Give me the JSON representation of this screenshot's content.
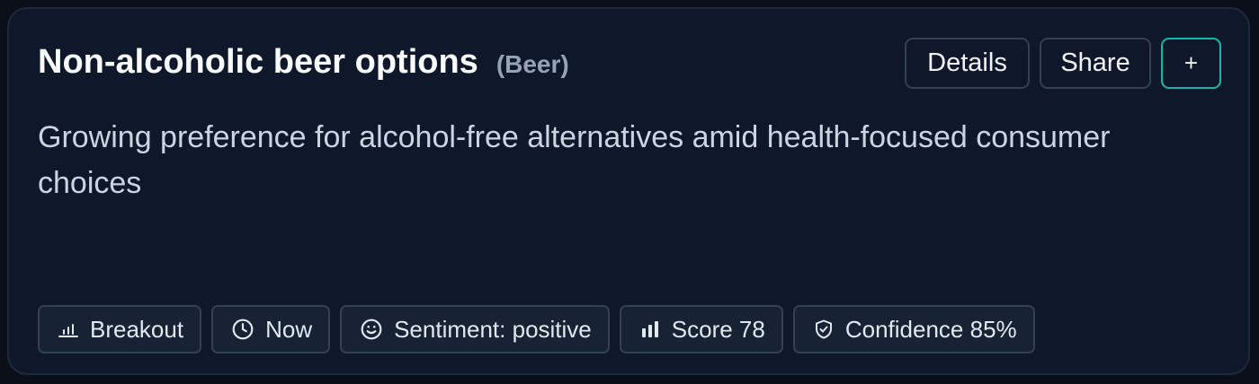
{
  "card": {
    "title": "Non-alcoholic beer options",
    "category": "(Beer)",
    "description": "Growing preference for alcohol-free alternatives amid health-focused consumer choices"
  },
  "actions": {
    "details_label": "Details",
    "share_label": "Share",
    "add_label": "+"
  },
  "chips": [
    {
      "icon": "bar-chart-icon",
      "label": "Breakout"
    },
    {
      "icon": "clock-icon",
      "label": "Now"
    },
    {
      "icon": "smile-icon",
      "label": "Sentiment: positive"
    },
    {
      "icon": "signal-bars-icon",
      "label": "Score 78"
    },
    {
      "icon": "shield-check-icon",
      "label": "Confidence 85%"
    }
  ],
  "colors": {
    "background": "#0f172a",
    "border": "#1e293b",
    "accent": "#14b8a6",
    "muted_text": "#94a3b8"
  }
}
